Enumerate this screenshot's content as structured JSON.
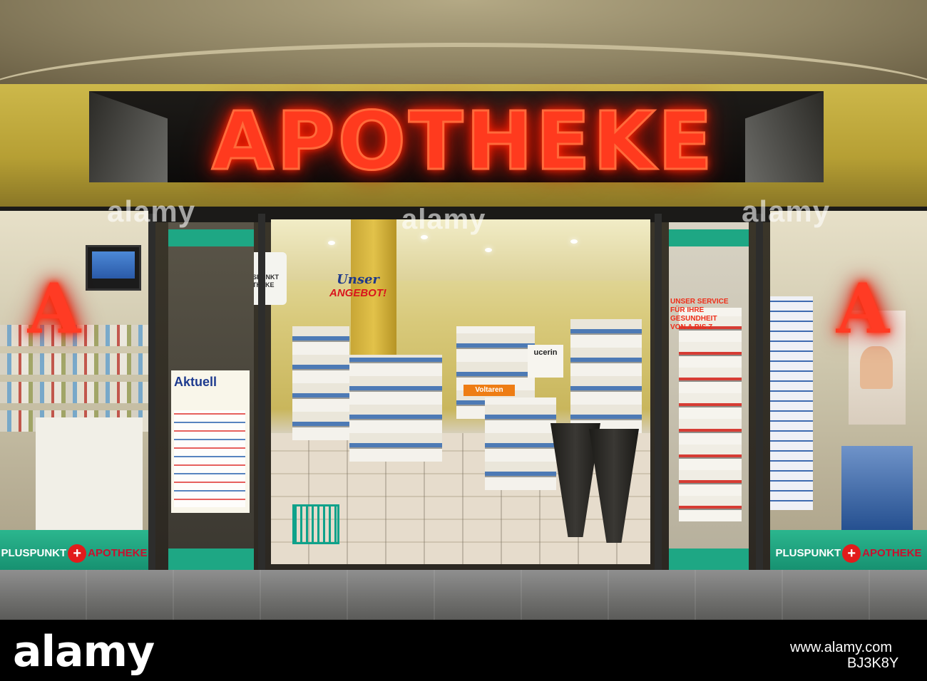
{
  "storefront": {
    "main_sign": "APOTHEKE",
    "pharmacy_symbol": "A",
    "window_banner_left": {
      "prefix": "PLUSPUNKT",
      "suffix": "APOTHEKE"
    },
    "window_banner_right": {
      "prefix": "PLUSPUNKT",
      "suffix": "APOTHEKE"
    }
  },
  "interior": {
    "angebot_line1": "Unser",
    "angebot_line2": "ANGEBOT!",
    "pluspunkt_line1": "SPUNKT",
    "pluspunkt_line2": "THEKE",
    "voltaren": "Voltaren",
    "eucerin": "ucerin",
    "service_lines": [
      "UNSER SERVICE",
      "FÜR IHRE",
      "GESUNDHEIT",
      "VON A BIS Z"
    ],
    "aktuell": "Aktuell"
  },
  "watermark": "alamy",
  "footer": {
    "logo": "alamy",
    "url": "www.alamy.com",
    "image_id": "BJ3K8Y"
  },
  "colors": {
    "neon_red": "#ff3a1e",
    "brand_green": "#1ea784",
    "fascia_yellow": "#c6b040"
  }
}
